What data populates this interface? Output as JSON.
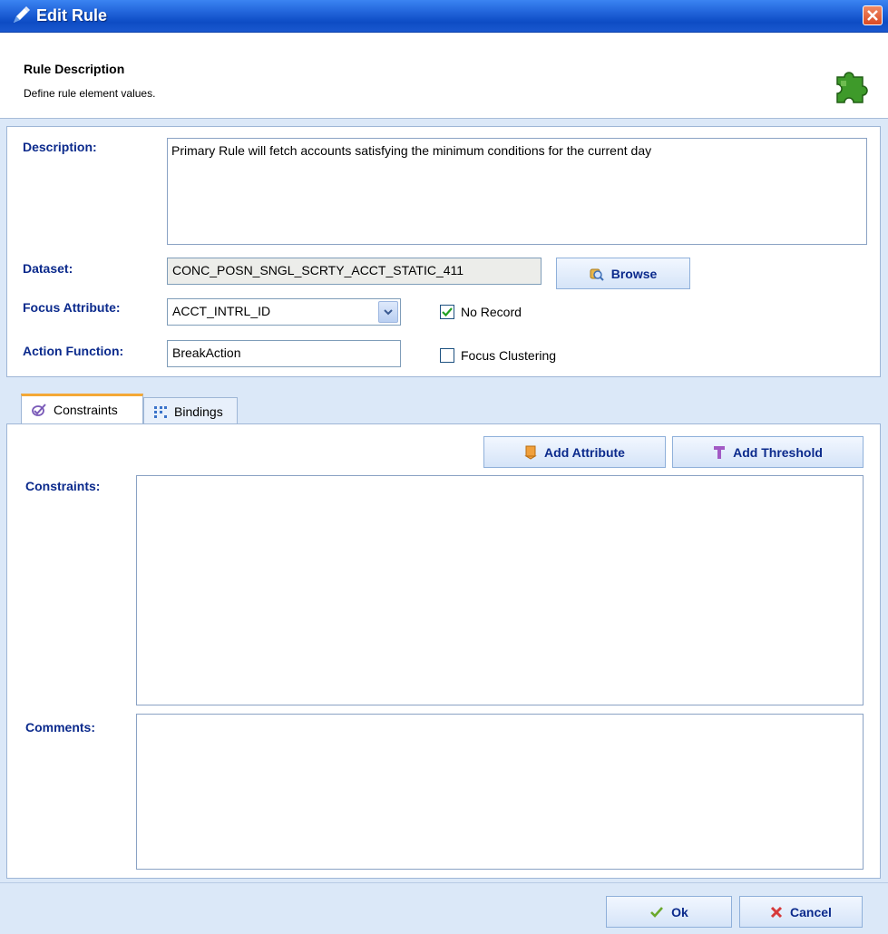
{
  "window": {
    "title": "Edit Rule"
  },
  "header": {
    "title": "Rule Description",
    "subtitle": "Define rule element values."
  },
  "form": {
    "description_label": "Description:",
    "description_value": "Primary Rule will fetch accounts satisfying the minimum conditions  for the current day",
    "dataset_label": "Dataset:",
    "dataset_value": "CONC_POSN_SNGL_SCRTY_ACCT_STATIC_411",
    "browse_label": "Browse",
    "focus_attribute_label": "Focus Attribute:",
    "focus_attribute_value": "ACCT_INTRL_ID",
    "action_function_label": "Action Function:",
    "action_function_value": "BreakAction",
    "no_record_label": "No Record",
    "no_record_checked": true,
    "focus_clustering_label": "Focus Clustering",
    "focus_clustering_checked": false
  },
  "tabs": [
    {
      "label": "Constraints",
      "active": true
    },
    {
      "label": "Bindings",
      "active": false
    }
  ],
  "constraints": {
    "add_attribute_label": "Add Attribute",
    "add_threshold_label": "Add Threshold",
    "constraints_label": "Constraints:",
    "constraints_value": "",
    "comments_label": "Comments:",
    "comments_value": ""
  },
  "footer": {
    "ok_label": "Ok",
    "cancel_label": "Cancel"
  },
  "colors": {
    "titlebar": "#1d5fd6",
    "label_text": "#0b2a8c",
    "active_tab_accent": "#f4a836",
    "dialog_background": "#dbe8f8"
  }
}
